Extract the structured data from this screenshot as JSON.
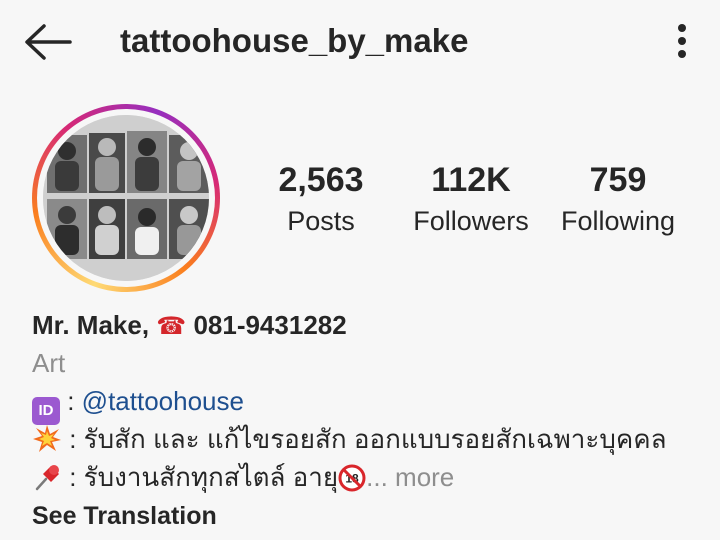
{
  "header": {
    "username": "tattoohouse_by_make",
    "back_icon": "arrow-left-icon",
    "more_icon": "more-vertical-icon"
  },
  "profile": {
    "avatar_ring_colors": [
      "#feda75",
      "#fa7e1e",
      "#d62976",
      "#962fbf"
    ]
  },
  "stats": [
    {
      "value": "2,563",
      "label": "Posts"
    },
    {
      "value": "112K",
      "label": "Followers"
    },
    {
      "value": "759",
      "label": "Following"
    }
  ],
  "bio": {
    "name": "Mr. Make,",
    "phone": "081-9431282",
    "category": "Art",
    "id_badge": "ID",
    "id_separator": " : ",
    "mention": "@tattoohouse",
    "line2_text": " : รับสัก และ แก้ไขรอยสัก ออกแบบรอยสักเฉพาะบุคคล",
    "line3_text": " : รับงานสักทุกสไตล์ อายุ",
    "age_badge": "18",
    "more_label": "... more",
    "see_translation": "See Translation"
  },
  "colors": {
    "mention": "#1e4f8f",
    "category": "#8e8e8e",
    "id_badge": "#9b59d0",
    "phone": "#d4262b"
  }
}
